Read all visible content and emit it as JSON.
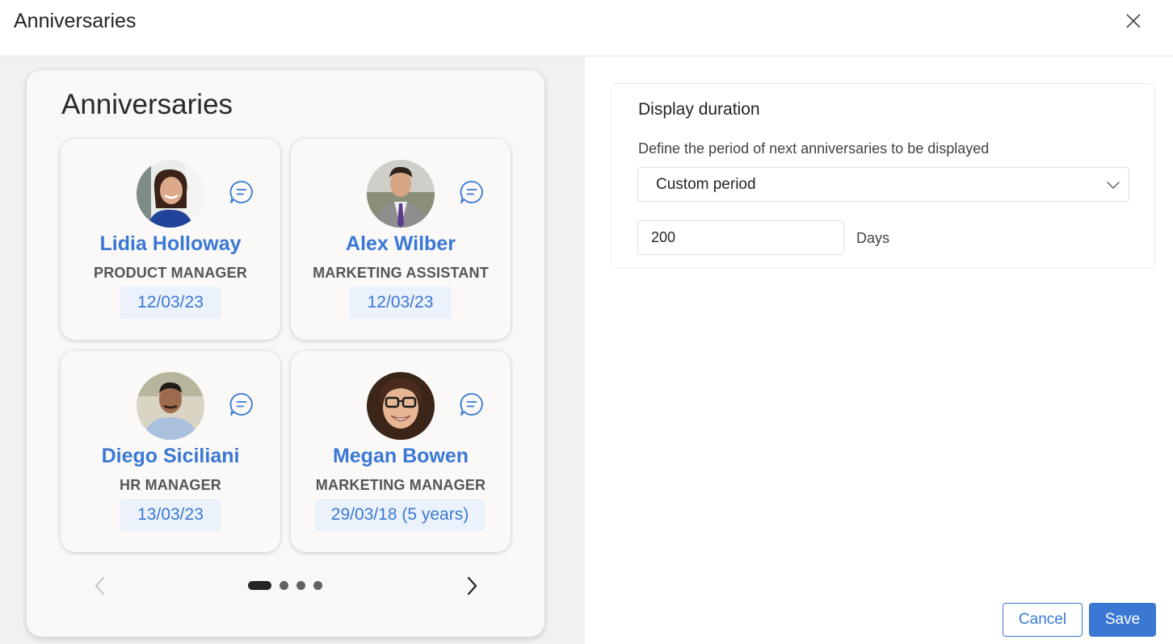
{
  "header": {
    "title": "Anniversaries",
    "close_icon": "close-icon"
  },
  "widget": {
    "title": "Anniversaries",
    "people": [
      {
        "name": "Lidia Holloway",
        "role": "PRODUCT MANAGER",
        "date": "12/03/23",
        "chat_icon": "chat-icon"
      },
      {
        "name": "Alex Wilber",
        "role": "MARKETING ASSISTANT",
        "date": "12/03/23",
        "chat_icon": "chat-icon"
      },
      {
        "name": "Diego Siciliani",
        "role": "HR MANAGER",
        "date": "13/03/23",
        "chat_icon": "chat-icon"
      },
      {
        "name": "Megan Bowen",
        "role": "MARKETING MANAGER",
        "date": "29/03/18 (5 years)",
        "chat_icon": "chat-icon"
      }
    ],
    "carousel": {
      "page_count": 4,
      "active_page": 1
    }
  },
  "settings": {
    "section_title": "Display duration",
    "description": "Define the period of next anniversaries to be displayed",
    "period_select": {
      "value": "Custom period"
    },
    "days_input": {
      "value": "200"
    },
    "days_label": "Days"
  },
  "footer": {
    "cancel_label": "Cancel",
    "save_label": "Save"
  },
  "colors": {
    "accent": "#3a78d4",
    "date_pill_bg": "#ebf2fb",
    "preview_bg": "#f2f1f0"
  }
}
